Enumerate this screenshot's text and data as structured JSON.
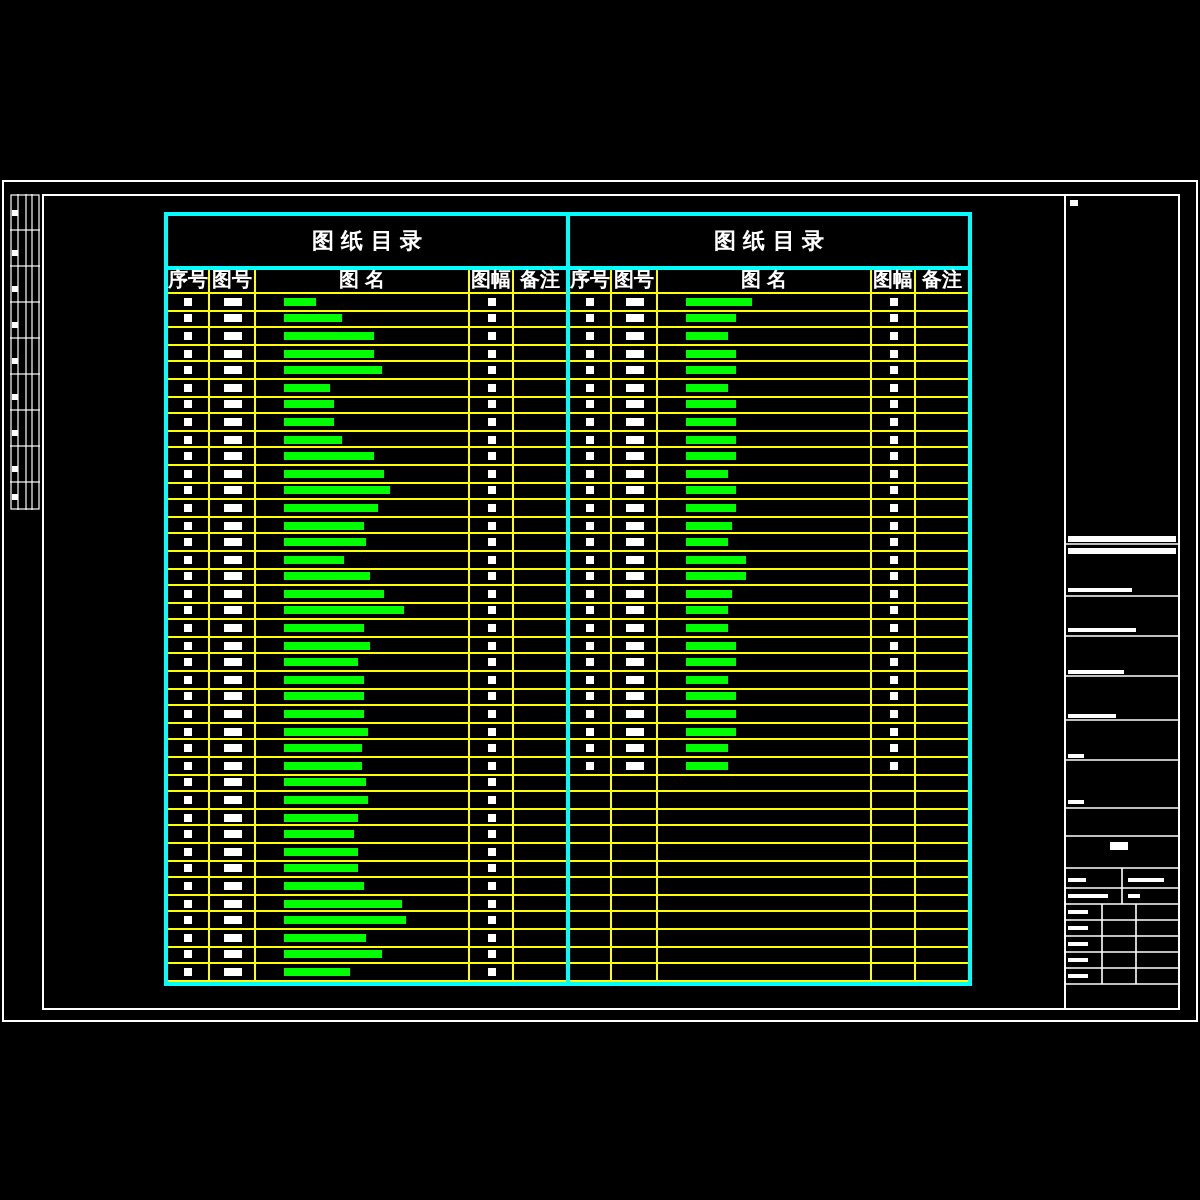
{
  "sheet": {
    "tables": [
      {
        "title": "图 纸 目 录",
        "columns": [
          "序号",
          "图号",
          "图 名",
          "图幅",
          "备注"
        ],
        "rows": [
          {
            "kind": "entry"
          },
          {
            "kind": "entry"
          },
          {
            "kind": "entry"
          },
          {
            "kind": "entry"
          },
          {
            "kind": "entry"
          },
          {
            "kind": "entry"
          },
          {
            "kind": "entry"
          },
          {
            "kind": "entry"
          },
          {
            "kind": "entry"
          },
          {
            "kind": "entry"
          },
          {
            "kind": "entry"
          },
          {
            "kind": "entry"
          },
          {
            "kind": "entry"
          },
          {
            "kind": "entry"
          },
          {
            "kind": "entry"
          },
          {
            "kind": "entry"
          },
          {
            "kind": "entry"
          },
          {
            "kind": "entry"
          },
          {
            "kind": "entry"
          },
          {
            "kind": "entry"
          },
          {
            "kind": "entry"
          },
          {
            "kind": "entry"
          },
          {
            "kind": "entry"
          },
          {
            "kind": "entry"
          },
          {
            "kind": "entry"
          },
          {
            "kind": "entry"
          },
          {
            "kind": "entry"
          },
          {
            "kind": "entry"
          },
          {
            "kind": "entry"
          },
          {
            "kind": "entry"
          },
          {
            "kind": "entry"
          },
          {
            "kind": "entry"
          },
          {
            "kind": "entry"
          },
          {
            "kind": "entry"
          },
          {
            "kind": "entry"
          },
          {
            "kind": "entry"
          },
          {
            "kind": "entry"
          },
          {
            "kind": "entry"
          },
          {
            "kind": "entry"
          },
          {
            "kind": "entry"
          }
        ]
      },
      {
        "title": "图 纸 目 录",
        "columns": [
          "序号",
          "图号",
          "图 名",
          "图幅",
          "备注"
        ],
        "rows": [
          {
            "kind": "entry"
          },
          {
            "kind": "entry"
          },
          {
            "kind": "entry"
          },
          {
            "kind": "entry"
          },
          {
            "kind": "entry"
          },
          {
            "kind": "entry"
          },
          {
            "kind": "entry"
          },
          {
            "kind": "entry"
          },
          {
            "kind": "entry"
          },
          {
            "kind": "entry"
          },
          {
            "kind": "entry"
          },
          {
            "kind": "entry"
          },
          {
            "kind": "entry"
          },
          {
            "kind": "entry"
          },
          {
            "kind": "entry"
          },
          {
            "kind": "entry"
          },
          {
            "kind": "entry"
          },
          {
            "kind": "entry"
          },
          {
            "kind": "entry"
          },
          {
            "kind": "entry"
          },
          {
            "kind": "entry"
          },
          {
            "kind": "entry"
          },
          {
            "kind": "entry"
          },
          {
            "kind": "entry"
          },
          {
            "kind": "entry"
          },
          {
            "kind": "entry"
          },
          {
            "kind": "entry"
          },
          {
            "kind": "entry"
          },
          {
            "kind": "empty"
          },
          {
            "kind": "empty"
          },
          {
            "kind": "empty"
          },
          {
            "kind": "empty"
          },
          {
            "kind": "empty"
          },
          {
            "kind": "empty"
          },
          {
            "kind": "empty"
          },
          {
            "kind": "empty"
          },
          {
            "kind": "empty"
          },
          {
            "kind": "empty"
          },
          {
            "kind": "empty"
          },
          {
            "kind": "empty"
          }
        ]
      }
    ]
  }
}
